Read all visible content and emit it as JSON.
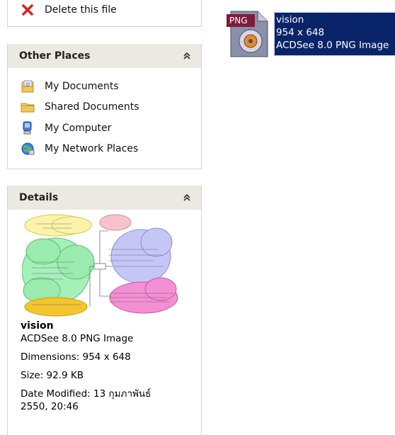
{
  "tasks": {
    "delete_label": "Delete this file"
  },
  "other_places": {
    "title": "Other Places",
    "items": [
      {
        "label": "My Documents",
        "icon": "my-documents-icon"
      },
      {
        "label": "Shared Documents",
        "icon": "folder-icon"
      },
      {
        "label": "My Computer",
        "icon": "my-computer-icon"
      },
      {
        "label": "My Network Places",
        "icon": "network-places-icon"
      }
    ]
  },
  "details": {
    "title": "Details",
    "name": "vision",
    "type": "ACDSee 8.0 PNG Image",
    "dimensions": "Dimensions: 954 x 648",
    "size": "Size: 92.9 KB",
    "date_modified": "Date Modified: 13 กุมภาพันธ์ 2550, 20:46"
  },
  "file": {
    "badge": "PNG",
    "name": "vision",
    "dimensions": "954 x 648",
    "type": "ACDSee 8.0 PNG Image"
  },
  "colors": {
    "selection": "#0a246a",
    "panel_header": "#ebe9e2"
  }
}
